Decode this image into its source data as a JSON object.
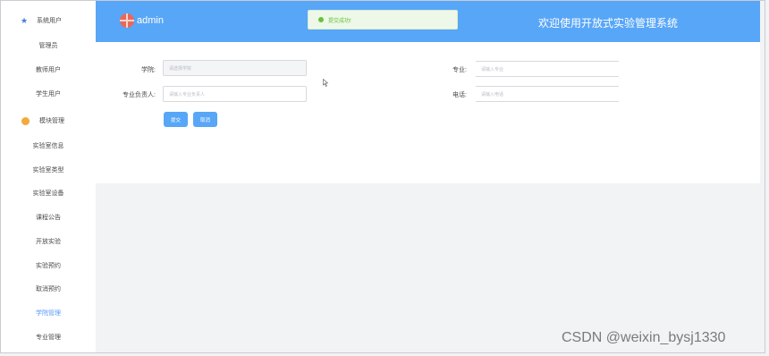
{
  "sidebar": {
    "items": [
      {
        "label": "系统用户",
        "group": true,
        "icon": "star-icon"
      },
      {
        "label": "管理员"
      },
      {
        "label": "教师用户"
      },
      {
        "label": "学生用户"
      },
      {
        "label": "模块管理",
        "group": true,
        "icon": "dot-icon"
      },
      {
        "label": "实验室信息"
      },
      {
        "label": "实验室类型"
      },
      {
        "label": "实验室设备"
      },
      {
        "label": "课程公告"
      },
      {
        "label": "开放实验"
      },
      {
        "label": "实验预约"
      },
      {
        "label": "取消预约"
      },
      {
        "label": "学院管理",
        "active": true
      },
      {
        "label": "专业管理"
      }
    ]
  },
  "header": {
    "username": "admin",
    "toast": "提交成功!",
    "welcome": "欢迎使用开放式实验管理系统",
    "accent_color": "#58a6f7"
  },
  "form": {
    "college_label": "学院:",
    "college_placeholder": "请选择学院",
    "major_label": "专业:",
    "major_placeholder": "请输入专业",
    "leader_label": "专业负责人:",
    "leader_placeholder": "请输入专业负责人",
    "phone_label": "电话:",
    "phone_placeholder": "请输入电话",
    "submit_label": "提交",
    "cancel_label": "取消"
  },
  "watermark": "CSDN @weixin_bysj1330"
}
